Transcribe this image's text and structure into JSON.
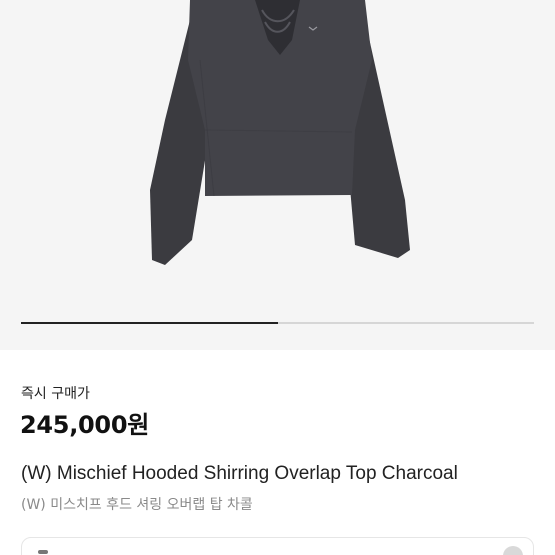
{
  "product": {
    "price_label": "즉시 구매가",
    "price": "245,000원",
    "title_en": "(W) Mischief Hooded Shirring Overlap Top Charcoal",
    "title_ko": "(W) 미스치프 후드 셔링 오버랩 탑 차콜"
  },
  "gallery": {
    "progress": 0.5
  },
  "colors": {
    "garment": "#3b3b40",
    "hero_background": "#f5f5f5",
    "progress_fill": "#222222",
    "progress_track": "#d6d6d6"
  },
  "icons": {
    "option_chevron": "chevron-circle-icon"
  }
}
